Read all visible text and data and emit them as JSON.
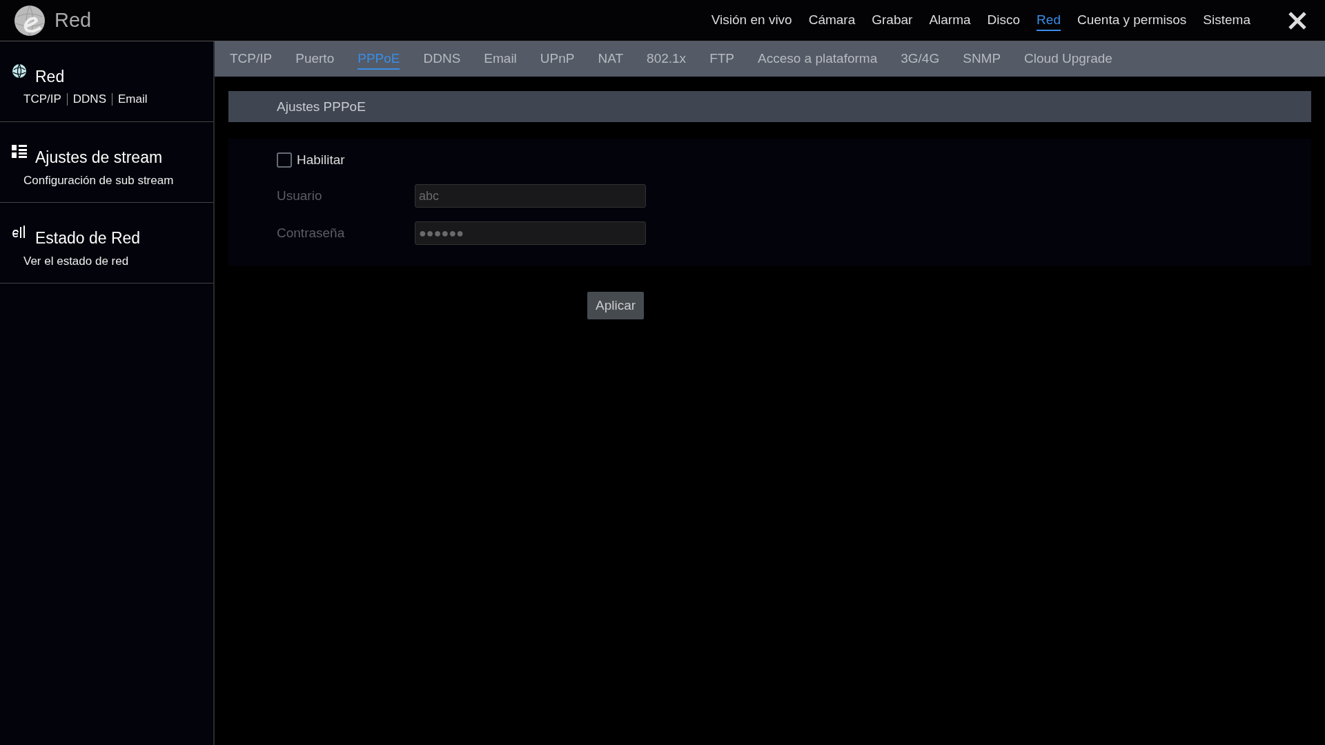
{
  "header": {
    "title": "Red",
    "nav": [
      {
        "label": "Visión en vivo",
        "selected": false
      },
      {
        "label": "Cámara",
        "selected": false
      },
      {
        "label": "Grabar",
        "selected": false
      },
      {
        "label": "Alarma",
        "selected": false
      },
      {
        "label": "Disco",
        "selected": false
      },
      {
        "label": "Red",
        "selected": true
      },
      {
        "label": "Cuenta y permisos",
        "selected": false
      },
      {
        "label": "Sistema",
        "selected": false
      }
    ]
  },
  "sidebar": {
    "items": [
      {
        "kind": "globe",
        "title": "Red",
        "links": [
          "TCP/IP",
          "DDNS",
          "Email"
        ]
      },
      {
        "kind": "grid",
        "title": "Ajustes de stream",
        "subtitle": "Configuración de sub stream"
      },
      {
        "kind": "status",
        "title": "Estado de Red",
        "subtitle": "Ver el estado de red"
      }
    ]
  },
  "tabs": [
    {
      "label": "TCP/IP",
      "selected": false
    },
    {
      "label": "Puerto",
      "selected": false
    },
    {
      "label": "PPPoE",
      "selected": true
    },
    {
      "label": "DDNS",
      "selected": false
    },
    {
      "label": "Email",
      "selected": false
    },
    {
      "label": "UPnP",
      "selected": false
    },
    {
      "label": "NAT",
      "selected": false
    },
    {
      "label": "802.1x",
      "selected": false
    },
    {
      "label": "FTP",
      "selected": false
    },
    {
      "label": "Acceso a plataforma",
      "selected": false
    },
    {
      "label": "3G/4G",
      "selected": false
    },
    {
      "label": "SNMP",
      "selected": false
    },
    {
      "label": "Cloud Upgrade",
      "selected": false
    }
  ],
  "section": {
    "title": "Ajustes PPPoE",
    "enable": {
      "label": "Habilitar",
      "checked": false
    },
    "fields": [
      {
        "label": "Usuario",
        "value": "abc",
        "disabled": true
      },
      {
        "label": "Contraseña",
        "value": "●●●●●●",
        "disabled": true
      }
    ],
    "apply_button": "Aplicar"
  }
}
